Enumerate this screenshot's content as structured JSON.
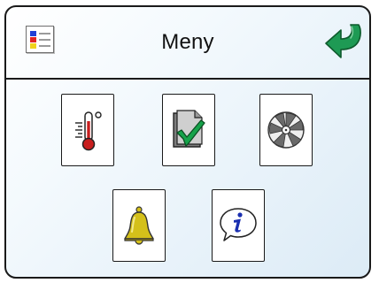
{
  "header": {
    "title": "Meny",
    "menu_icon": "menu-list-icon",
    "back_icon": "back-arrow-icon"
  },
  "tiles": [
    {
      "name": "temperature",
      "icon": "thermometer-icon"
    },
    {
      "name": "checklist",
      "icon": "document-check-icon"
    },
    {
      "name": "fan",
      "icon": "fan-icon"
    },
    {
      "name": "alarm",
      "icon": "bell-icon"
    },
    {
      "name": "info",
      "icon": "info-icon"
    }
  ],
  "colors": {
    "border": "#1a1a1a",
    "accent_green": "#1e9a54",
    "bell_gold": "#d4c01a",
    "info_blue": "#1a2fb0",
    "thermo_red": "#c81e1e"
  }
}
